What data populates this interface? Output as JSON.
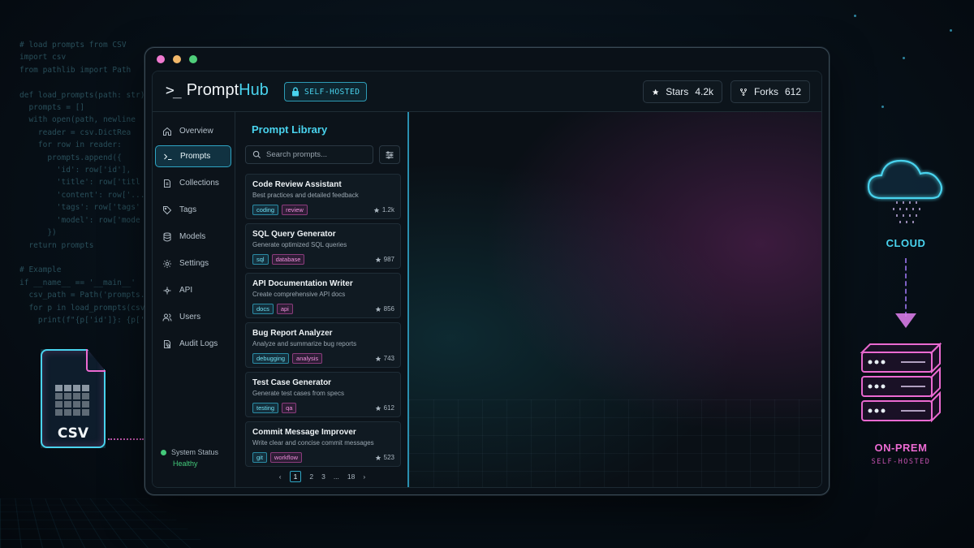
{
  "background": {
    "code_lines": [
      "# load prompts from CSV",
      "import csv",
      "from pathlib import Path",
      "",
      "def load_prompts(path: str):",
      "  prompts = []",
      "  with open(path, newline",
      "    reader = csv.DictRea",
      "    for row in reader:",
      "      prompts.append({",
      "        'id': row['id'],",
      "        'title': row['titl",
      "        'content': row['...",
      "        'tags': row['tags'",
      "        'model': row['mode",
      "      })",
      "  return prompts",
      "",
      "# Example",
      "if __name__ == '__main__'",
      "  csv_path = Path('prompts.cs",
      "  for p in load_prompts(csv_pa",
      "    print(f\"{p['id']}: {p['ti"
    ],
    "csv_label": "CSV",
    "cloud_label": "CLOUD",
    "onprem_label": "ON-PREM",
    "selfhosted_label": "SELF-HOSTED",
    "colors": {
      "cyan": "#49d3ee",
      "magenta": "#ec6ad2",
      "green": "#43c97a"
    }
  },
  "header": {
    "logo_mark": ">_",
    "logo_prefix": "Prompt",
    "logo_suffix": "Hub",
    "badge": "SELF-HOSTED",
    "stars_label": "Stars",
    "stars_value": "4.2k",
    "forks_label": "Forks",
    "forks_value": "612"
  },
  "sidebar": {
    "items": [
      {
        "label": "Overview",
        "icon": "home-icon"
      },
      {
        "label": "Prompts",
        "icon": "terminal-icon",
        "active": true
      },
      {
        "label": "Collections",
        "icon": "file-icon"
      },
      {
        "label": "Tags",
        "icon": "tag-icon"
      },
      {
        "label": "Models",
        "icon": "database-icon"
      },
      {
        "label": "Settings",
        "icon": "gear-icon"
      },
      {
        "label": "API",
        "icon": "api-icon"
      },
      {
        "label": "Users",
        "icon": "users-icon"
      },
      {
        "label": "Audit Logs",
        "icon": "audit-icon"
      }
    ],
    "status_label": "System Status",
    "status_value": "Healthy"
  },
  "library": {
    "title": "Prompt Library",
    "search_placeholder": "Search prompts...",
    "cards": [
      {
        "title": "Code Review Assistant",
        "desc": "Best practices and detailed feedback",
        "tags": [
          "coding",
          "review"
        ],
        "stars": "1.2k"
      },
      {
        "title": "SQL Query Generator",
        "desc": "Generate optimized SQL queries",
        "tags": [
          "sql",
          "database"
        ],
        "stars": "987"
      },
      {
        "title": "API Documentation Writer",
        "desc": "Create comprehensive API docs",
        "tags": [
          "docs",
          "api"
        ],
        "stars": "856"
      },
      {
        "title": "Bug Report Analyzer",
        "desc": "Analyze and summarize bug reports",
        "tags": [
          "debugging",
          "analysis"
        ],
        "stars": "743"
      },
      {
        "title": "Test Case Generator",
        "desc": "Generate test cases from specs",
        "tags": [
          "testing",
          "qa"
        ],
        "stars": "612"
      },
      {
        "title": "Commit Message Improver",
        "desc": "Write clear and concise commit messages",
        "tags": [
          "git",
          "workflow"
        ],
        "stars": "523"
      }
    ],
    "pagination": {
      "prev": "‹",
      "pages": [
        "1",
        "2",
        "3",
        "...",
        "18"
      ],
      "current": "1",
      "next": "›"
    }
  }
}
